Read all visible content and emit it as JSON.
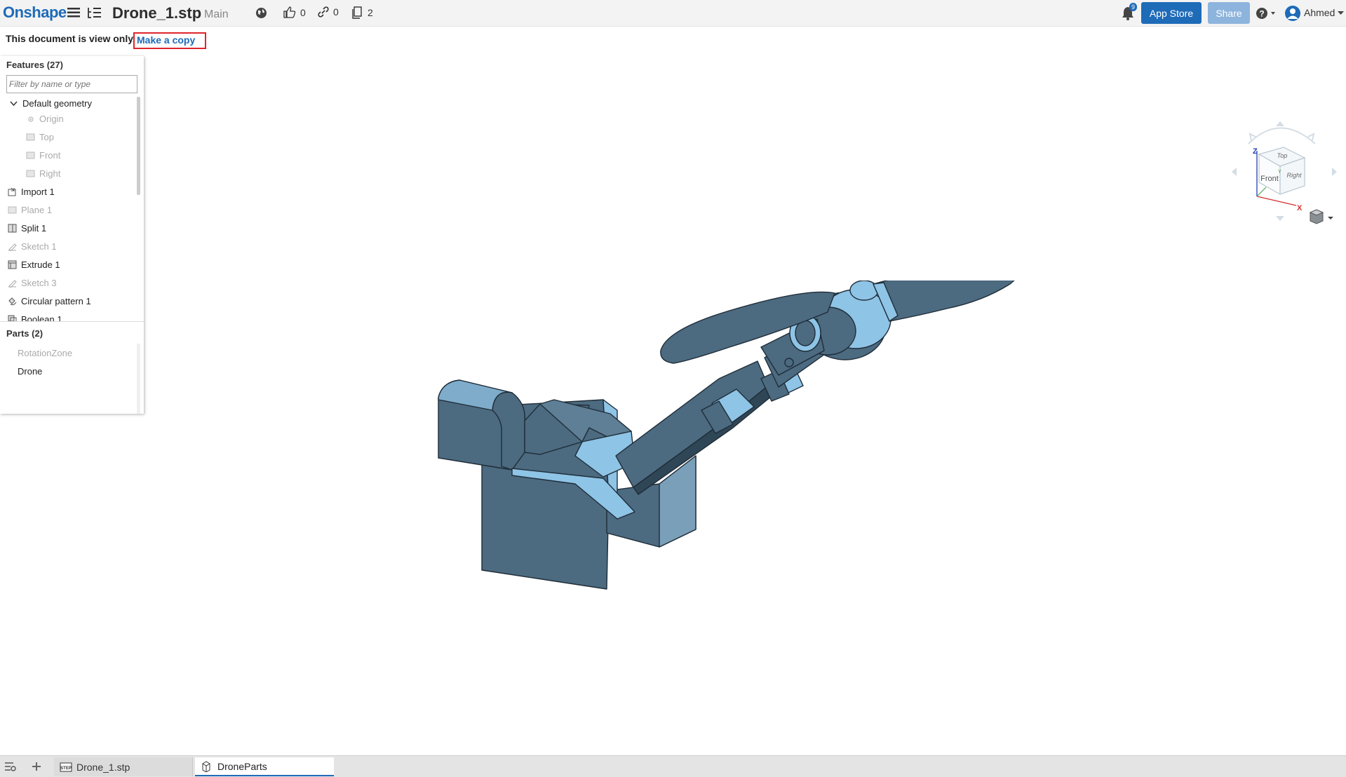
{
  "app": {
    "logo": "Onshape"
  },
  "document": {
    "title": "Drone_1.stp",
    "branch": "Main"
  },
  "stats": {
    "likes": "0",
    "links": "0",
    "copies": "2"
  },
  "notifications": {
    "count": "9"
  },
  "buttons": {
    "app_store": "App Store",
    "share": "Share"
  },
  "user": {
    "name": "Ahmed"
  },
  "notice": {
    "text": "This document is view only.",
    "link": "Make a copy"
  },
  "features": {
    "header": "Features (27)",
    "filter_placeholder": "Filter by name or type",
    "items": [
      {
        "label": "Default geometry",
        "icon": "chevron-down-icon"
      },
      {
        "label": "Origin",
        "icon": "origin-icon"
      },
      {
        "label": "Top",
        "icon": "plane-icon"
      },
      {
        "label": "Front",
        "icon": "plane-icon"
      },
      {
        "label": "Right",
        "icon": "plane-icon"
      },
      {
        "label": "Import 1",
        "icon": "import-icon"
      },
      {
        "label": "Plane 1",
        "icon": "plane-icon"
      },
      {
        "label": "Split 1",
        "icon": "split-icon"
      },
      {
        "label": "Sketch 1",
        "icon": "sketch-icon"
      },
      {
        "label": "Extrude 1",
        "icon": "extrude-icon"
      },
      {
        "label": "Sketch 3",
        "icon": "sketch-icon"
      },
      {
        "label": "Circular pattern 1",
        "icon": "circular-pattern-icon"
      },
      {
        "label": "Boolean 1",
        "icon": "boolean-icon"
      }
    ]
  },
  "parts": {
    "header": "Parts (2)",
    "items": [
      {
        "label": "RotationZone"
      },
      {
        "label": "Drone"
      }
    ]
  },
  "viewcube": {
    "top": "Top",
    "front": "Front",
    "right": "Right",
    "axis_z": "Z",
    "axis_x": "X",
    "axis_y": "Y"
  },
  "tabs": [
    {
      "label": "Drone_1.stp"
    },
    {
      "label": "DroneParts"
    }
  ],
  "colors": {
    "accent": "#1e6bb8",
    "model_dark": "#4a6b82",
    "model_light": "#8ec4e6"
  }
}
